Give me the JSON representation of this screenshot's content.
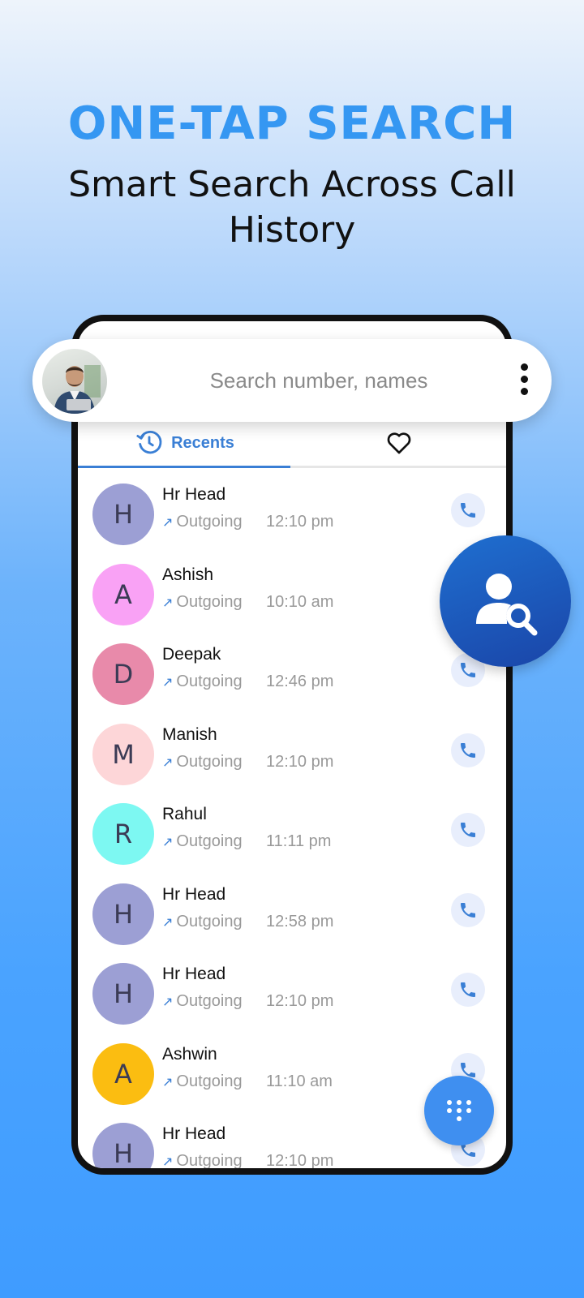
{
  "promo": {
    "headline": "ONE-TAP SEARCH",
    "subheadline": "Smart Search Across Call History"
  },
  "search": {
    "placeholder": "Search number, names",
    "avatar_icon": "user-photo",
    "menu_icon": "more-vertical-icon"
  },
  "tabs": [
    {
      "label": "Recents",
      "icon": "history-icon",
      "active": true
    },
    {
      "label": "",
      "icon": "heart-icon",
      "active": false
    }
  ],
  "calls": [
    {
      "initial": "H",
      "name": "Hr Head",
      "direction": "Outgoing",
      "time": "12:10 pm",
      "color": "#9c9fd4"
    },
    {
      "initial": "A",
      "name": "Ashish",
      "direction": "Outgoing",
      "time": "10:10 am",
      "color": "#f9a2f5"
    },
    {
      "initial": "D",
      "name": "Deepak",
      "direction": "Outgoing",
      "time": "12:46 pm",
      "color": "#e88aaa"
    },
    {
      "initial": "M",
      "name": "Manish",
      "direction": "Outgoing",
      "time": "12:10 pm",
      "color": "#fdd6d8"
    },
    {
      "initial": "R",
      "name": "Rahul",
      "direction": "Outgoing",
      "time": "11:11 pm",
      "color": "#7df8f2"
    },
    {
      "initial": "H",
      "name": "Hr Head",
      "direction": "Outgoing",
      "time": "12:58 pm",
      "color": "#9c9fd4"
    },
    {
      "initial": "H",
      "name": "Hr Head",
      "direction": "Outgoing",
      "time": "12:10 pm",
      "color": "#9c9fd4"
    },
    {
      "initial": "A",
      "name": "Ashwin",
      "direction": "Outgoing",
      "time": "11:10 am",
      "color": "#fbbd11"
    },
    {
      "initial": "H",
      "name": "Hr Head",
      "direction": "Outgoing",
      "time": "12:10 pm",
      "color": "#9c9fd4"
    }
  ],
  "fab": {
    "search_icon": "person-search-icon",
    "dialpad_icon": "dialpad-icon"
  },
  "colors": {
    "accent": "#3a7fd5",
    "headline": "#3597f2",
    "fab_search": "#1a45a8",
    "fab_dial": "#3f8ff0"
  }
}
